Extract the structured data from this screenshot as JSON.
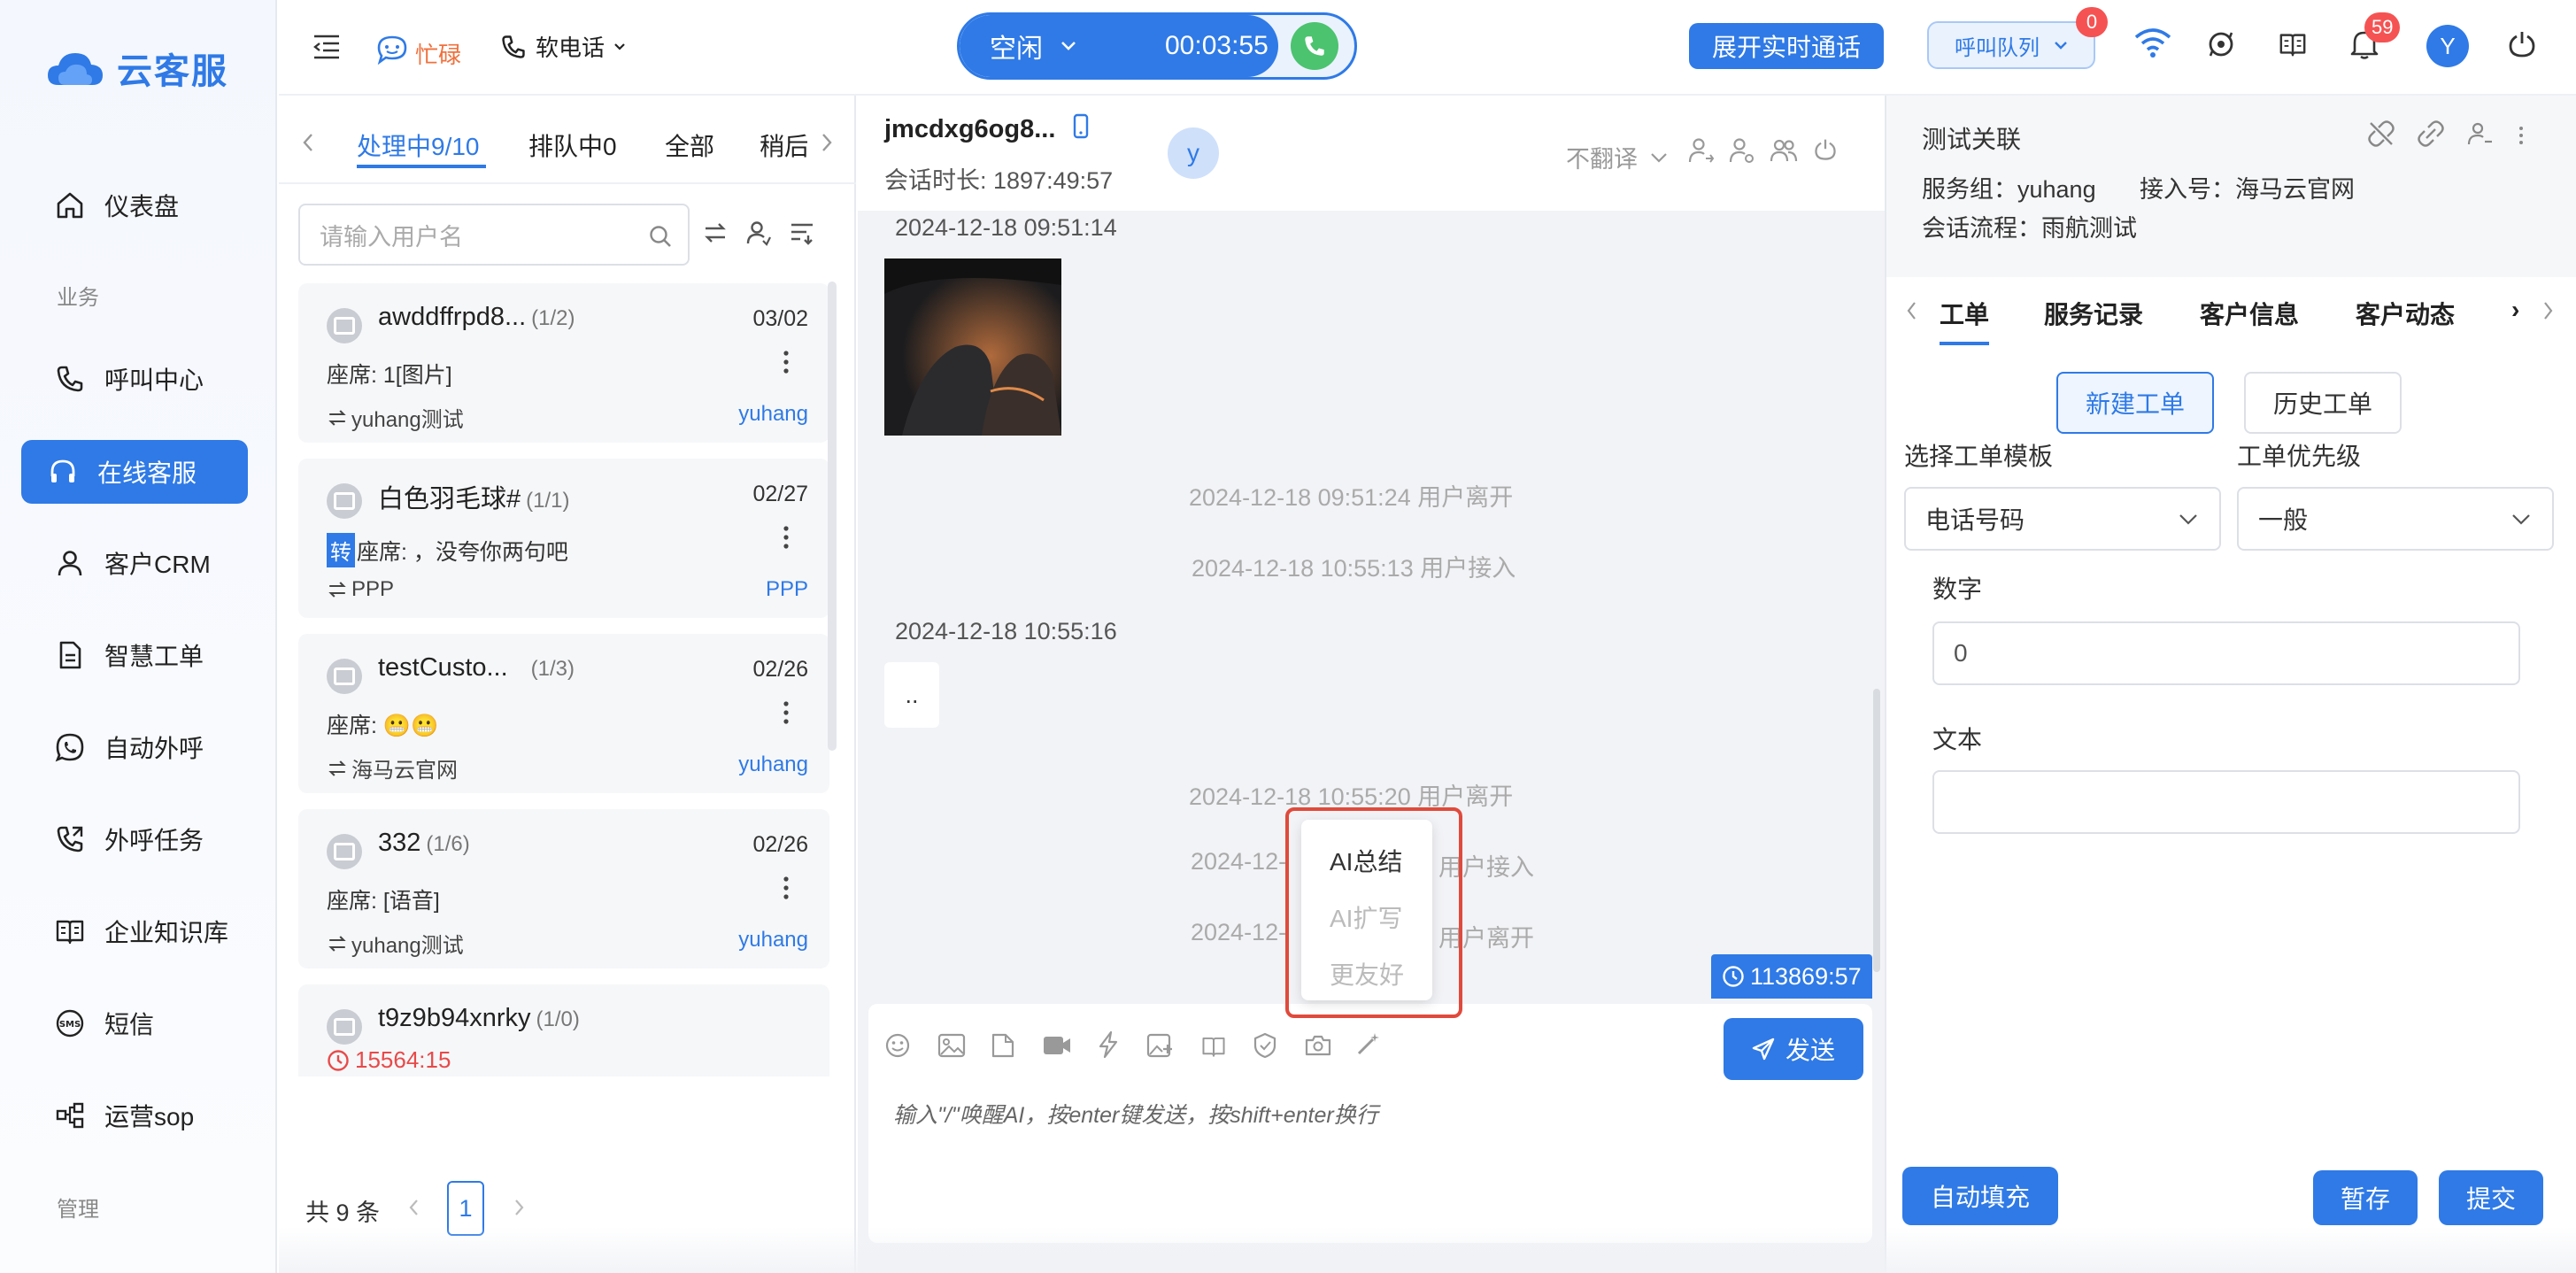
{
  "app": {
    "logo_text": "云客服"
  },
  "sidebar": {
    "items": [
      {
        "label": "仪表盘",
        "icon": "home-icon"
      },
      {
        "label": "呼叫中心",
        "icon": "phone-icon"
      },
      {
        "label": "在线客服",
        "icon": "headset-icon"
      },
      {
        "label": "客户CRM",
        "icon": "user-icon"
      },
      {
        "label": "智慧工单",
        "icon": "document-icon"
      },
      {
        "label": "自动外呼",
        "icon": "whatsapp-icon"
      },
      {
        "label": "外呼任务",
        "icon": "phone-outgoing-icon"
      },
      {
        "label": "企业知识库",
        "icon": "book-icon"
      },
      {
        "label": "短信",
        "icon": "sms-icon"
      },
      {
        "label": "运营sop",
        "icon": "flow-icon"
      }
    ],
    "section_business": "业务",
    "section_manage": "管理"
  },
  "topbar": {
    "busy_label": "忙碌",
    "softphone_label": "软电话",
    "status_label": "空闲",
    "timer": "00:03:55",
    "realtime_button": "展开实时通话",
    "queue_label": "呼叫队列",
    "queue_badge": "0",
    "notify_badge": "59",
    "avatar_letter": "Y"
  },
  "convlist": {
    "tabs": [
      "处理中9/10",
      "排队中0",
      "全部",
      "稍后"
    ],
    "search_placeholder": "请输入用户名",
    "items": [
      {
        "name": "awddffrpd8...",
        "count": "(1/2)",
        "date": "03/02",
        "msg": "座席: 1[图片]",
        "group": "yuhang测试",
        "agent": "yuhang"
      },
      {
        "name": "白色羽毛球#",
        "count": "(1/1)",
        "date": "02/27",
        "tag": "转",
        "msg": "座席: ，没夸你两句吧",
        "group": "PPP",
        "agent": "PPP"
      },
      {
        "name": "testCusto...",
        "count": "(1/3)",
        "date": "02/26",
        "msg": "座席: 😬😬",
        "group": "海马云官网",
        "agent": "yuhang"
      },
      {
        "name": "332",
        "count": "(1/6)",
        "date": "02/26",
        "msg": "座席: [语音]",
        "group": "yuhang测试",
        "agent": "yuhang"
      },
      {
        "name": "t9z9b94xnrky",
        "count": "(1/0)",
        "timer": "15564:15"
      }
    ],
    "pagination": {
      "total": "共 9 条",
      "page": "1"
    }
  },
  "chat": {
    "user_name": "jmcdxg6og8...",
    "duration": "会话时长: 1897:49:57",
    "avatar_letter": "y",
    "translate_label": "不翻译",
    "messages": {
      "ts1": "2024-12-18 09:51:14",
      "sys1": "2024-12-18 09:51:24 用户离开",
      "sys2": "2024-12-18 10:55:13 用户接入",
      "ts2": "2024-12-18 10:55:16",
      "bubble": "..",
      "sys3": "2024-12-18 10:55:20 用户离开",
      "sys4_left": "2024-12-",
      "sys4_right": "用户接入",
      "sys5_left": "2024-12-",
      "sys5_right": "用户离开"
    },
    "session_timer": "113869:57",
    "compose_placeholder": "输入\"/\"唤醒AI，按enter键发送，按shift+enter换行",
    "send_button": "发送",
    "ai_menu": [
      "AI总结",
      "AI扩写",
      "更友好"
    ]
  },
  "rightpanel": {
    "title": "测试关联",
    "service_group": "服务组：yuhang",
    "access_number": "接入号：海马云官网",
    "flow": "会话流程：雨航测试",
    "tabs": [
      "工单",
      "服务记录",
      "客户信息",
      "客户动态"
    ],
    "new_ticket": "新建工单",
    "history_ticket": "历史工单",
    "template_label": "选择工单模板",
    "template_value": "电话号码",
    "priority_label": "工单优先级",
    "priority_value": "一般",
    "number_label": "数字",
    "number_value": "0",
    "text_label": "文本",
    "autofill": "自动填充",
    "save_draft": "暂存",
    "submit": "提交"
  }
}
